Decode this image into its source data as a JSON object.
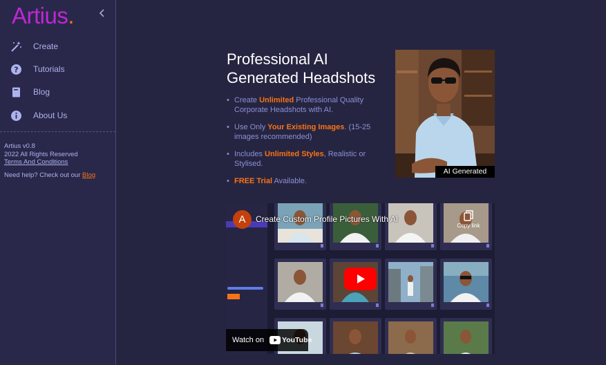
{
  "sidebar": {
    "brand": "Artius",
    "brand_dot": ".",
    "items": [
      {
        "label": "Create",
        "icon": "magic-wand-icon"
      },
      {
        "label": "Tutorials",
        "icon": "question-circle-icon"
      },
      {
        "label": "Blog",
        "icon": "book-icon"
      },
      {
        "label": "About Us",
        "icon": "info-circle-icon"
      }
    ],
    "version": "Artius v0.8",
    "rights": "2022 All Rights Reserved",
    "terms": "Terms And Conditions",
    "help_prefix": "Need help? Check out our ",
    "help_link": "Blog"
  },
  "hero": {
    "title": "Professional AI Generated Headshots",
    "features": [
      {
        "pre": "Create ",
        "hl": "Unlimited",
        "post": " Professional Quality Corporate Headshots with AI."
      },
      {
        "pre": "Use Only ",
        "hl": "Your Existing Images",
        "post": ". (15-25 images recommended)"
      },
      {
        "pre": "Includes ",
        "hl": "Unlimited Styles",
        "post": ", Realistic or Stylised."
      },
      {
        "pre": "",
        "hl": "FREE Trial",
        "post": " Available."
      }
    ],
    "badge": "AI Generated"
  },
  "video": {
    "channel_initial": "A",
    "title": "Create Custom Profile Pictures With AI",
    "copy_label": "Copy link",
    "watch_label": "Watch on",
    "youtube_label": "YouTube"
  },
  "colors": {
    "accent": "#f97316",
    "brand": "#c026d3",
    "background": "#262541"
  }
}
